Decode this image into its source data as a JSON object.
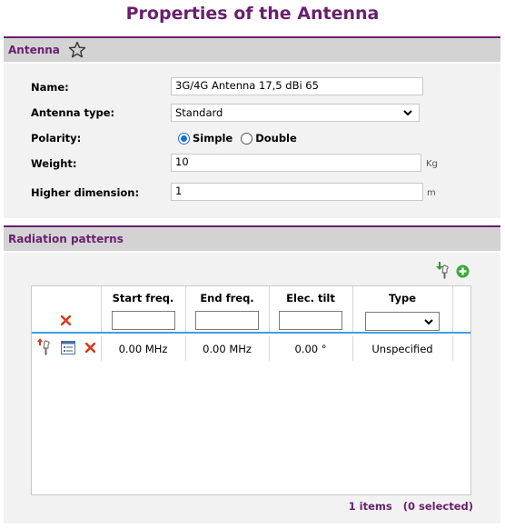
{
  "page": {
    "title": "Properties of the Antenna"
  },
  "antenna_section": {
    "title": "Antenna",
    "name": {
      "label": "Name:",
      "value": "3G/4G Antenna 17,5 dBi 65"
    },
    "antenna_type": {
      "label": "Antenna type:",
      "value": "Standard"
    },
    "polarity": {
      "label": "Polarity:",
      "options": [
        "Simple",
        "Double"
      ],
      "selected": "Simple"
    },
    "weight": {
      "label": "Weight:",
      "value": "10",
      "unit": "Kg"
    },
    "higher_dimension": {
      "label": "Higher dimension:",
      "value": "1",
      "unit": "m"
    }
  },
  "radiation_section": {
    "title": "Radiation patterns",
    "columns": [
      "Start freq.",
      "End freq.",
      "Elec. tilt",
      "Type"
    ],
    "rows": [
      {
        "start_freq": "0.00 MHz",
        "end_freq": "0.00 MHz",
        "elec_tilt": "0.00 °",
        "type": "Unspecified"
      }
    ],
    "footer": "1 items   (0 selected)"
  },
  "colors": {
    "accent": "#6a1f6e",
    "header_bg": "#d3d3d3",
    "body_bg": "#f2f2f2",
    "selection": "#3e9fe0"
  }
}
